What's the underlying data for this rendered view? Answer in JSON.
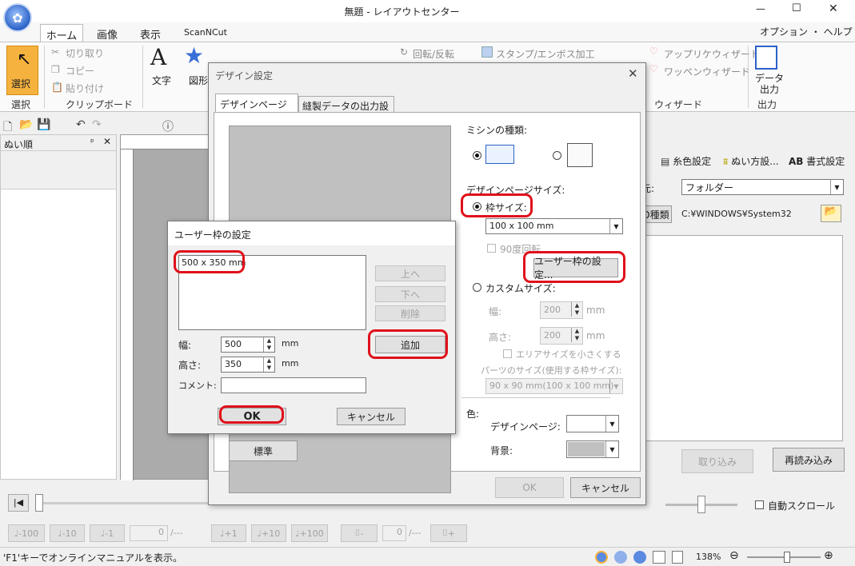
{
  "window": {
    "title": "無題 - レイアウトセンター",
    "minimize": "—",
    "maximize": "☐",
    "close": "✕"
  },
  "menu": {
    "tabs": [
      "ホーム",
      "画像",
      "表示",
      "ScanNCut"
    ],
    "options": "オプション ・ ヘルプ ・"
  },
  "ribbon": {
    "select": "選択",
    "select_group": "選択",
    "cut": "切り取り",
    "copy": "コピー",
    "paste": "貼り付け",
    "clipboard_group": "クリップボード",
    "text": "文字",
    "shape": "図形",
    "rotate": "回転/反転",
    "stamp": "スタンプ/エンボス加工",
    "app_wizard": "アップリケウィザード",
    "wappen_wizard": "ワッペンウィザード",
    "wizard_group": "ウィザード",
    "data_output": "データ出力",
    "output_group": "出力"
  },
  "left_panel": {
    "title": "ぬい順"
  },
  "right_panel": {
    "tabs": [
      "糸色設定",
      "ぬい方設...",
      "書式設定"
    ],
    "source_label": "元:",
    "source_value": "フォルダー",
    "kind_button": "D種類",
    "path": "C:¥WINDOWS¥System32",
    "import_button": "取り込み",
    "reload_button": "再読み込み"
  },
  "bottom_bar": {
    "auto_scroll": "自動スクロール",
    "step_buttons": [
      "-100",
      "-10",
      "-1",
      "+1",
      "+10",
      "+100"
    ],
    "counter1": "0",
    "counter1_total": "/---",
    "counter2": "0",
    "counter2_total": "/---",
    "minus": "-",
    "plus": "+"
  },
  "status": {
    "hint": "'F1'キーでオンラインマニュアルを表示。",
    "zoom": "138%"
  },
  "design_dialog": {
    "title": "デザイン設定",
    "tab_page": "デザインページ設定",
    "tab_output": "縫製データの出力設定",
    "machine_label": "ミシンの種類:",
    "page_size_label": "デザインページサイズ:",
    "frame_size_label": "枠サイズ:",
    "frame_size_value": "100 x 100 mm",
    "rotate_label": "90度回転",
    "user_frame_button": "ユーザー枠の設定...",
    "custom_size_label": "カスタムサイズ:",
    "width_label": "幅:",
    "width_value": "200",
    "height_label": "高さ:",
    "height_value": "200",
    "unit": "mm",
    "reduce_area": "エリアサイズを小さくする",
    "parts_size_label": "パーツのサイズ(使用する枠サイズ):",
    "parts_size_value": "90 x 90 mm(100 x 100 mm)",
    "color_label": "色:",
    "design_page_color": "デザインページ:",
    "background_color": "背景:",
    "standard_button": "標準",
    "ok_button": "OK",
    "cancel_button": "キャンセル"
  },
  "user_frame_dialog": {
    "title": "ユーザー枠の設定",
    "list_items": [
      "500 x 350 mm"
    ],
    "up_button": "上へ",
    "down_button": "下へ",
    "delete_button": "削除",
    "add_button": "追加",
    "width_label": "幅:",
    "width_value": "500",
    "height_label": "高さ:",
    "height_value": "350",
    "unit": "mm",
    "comment_label": "コメント:",
    "comment_value": "",
    "ok_button": "OK",
    "cancel_button": "キャンセル"
  },
  "colors": {
    "accent_blue": "#2b62c8",
    "highlight": "#e0101a",
    "ribbon_orange": "#f6b23e"
  }
}
